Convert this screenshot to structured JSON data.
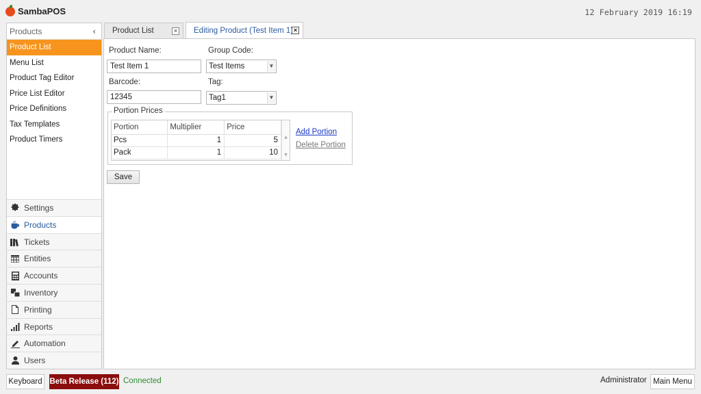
{
  "app": {
    "name": "SambaPOS",
    "clock": "12 February 2019 16:19"
  },
  "sidebar": {
    "title": "Products",
    "collapse_glyph": "‹",
    "items": [
      {
        "label": "Product List",
        "active": true
      },
      {
        "label": "Menu List"
      },
      {
        "label": "Product Tag Editor"
      },
      {
        "label": "Price List Editor"
      },
      {
        "label": "Price Definitions"
      },
      {
        "label": "Tax Templates"
      },
      {
        "label": "Product Timers"
      }
    ],
    "modules": [
      {
        "label": "Settings",
        "icon": "gear-icon"
      },
      {
        "label": "Products",
        "icon": "cup-icon",
        "active": true
      },
      {
        "label": "Tickets",
        "icon": "tickets-icon"
      },
      {
        "label": "Entities",
        "icon": "table-icon"
      },
      {
        "label": "Accounts",
        "icon": "calculator-icon"
      },
      {
        "label": "Inventory",
        "icon": "boxes-icon"
      },
      {
        "label": "Printing",
        "icon": "document-icon"
      },
      {
        "label": "Reports",
        "icon": "bar-chart-icon"
      },
      {
        "label": "Automation",
        "icon": "pencil-icon"
      },
      {
        "label": "Users",
        "icon": "user-icon"
      }
    ]
  },
  "tabs": [
    {
      "label": "Product List",
      "close": "×"
    },
    {
      "label": "Editing Product (Test Item 1)",
      "close": "×"
    }
  ],
  "form": {
    "product_name_label": "Product Name:",
    "product_name_value": "Test Item 1",
    "group_code_label": "Group Code:",
    "group_code_value": "Test Items",
    "barcode_label": "Barcode:",
    "barcode_value": "12345",
    "tag_label": "Tag:",
    "tag_value": "Tag1",
    "portion_prices_title": "Portion Prices",
    "grid_headers": [
      "Portion",
      "Multiplier",
      "Price"
    ],
    "grid_rows": [
      {
        "portion": "Pcs",
        "multiplier": "1",
        "price": "5"
      },
      {
        "portion": "Pack",
        "multiplier": "1",
        "price": "10"
      }
    ],
    "add_portion": "Add Portion",
    "delete_portion": "Delete Portion",
    "save_label": "Save"
  },
  "status": {
    "keyboard_label": "Keyboard",
    "beta_label": "Beta Release (112)",
    "connection": "Connected",
    "user": "Administrator",
    "main_menu_label": "Main Menu"
  },
  "colors": {
    "accent": "#f7941d",
    "beta": "#8b0d0d",
    "link": "#1a37c5",
    "connected": "#2f8a2f"
  }
}
